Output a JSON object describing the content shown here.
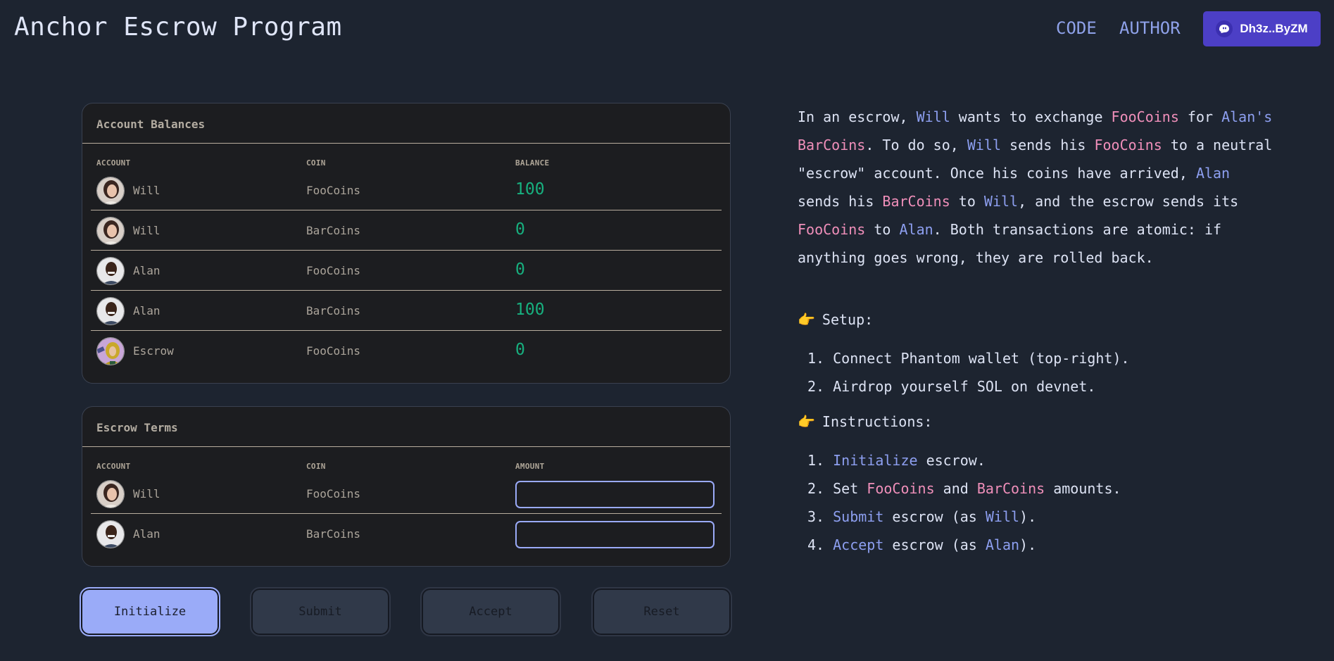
{
  "header": {
    "title": "Anchor Escrow Program",
    "nav": [
      {
        "label": "CODE"
      },
      {
        "label": "AUTHOR"
      }
    ],
    "wallet": {
      "icon": "phantom-ghost-icon",
      "label": "Dh3z..ByZM"
    }
  },
  "balances": {
    "title": "Account Balances",
    "columns": [
      "ACCOUNT",
      "COIN",
      "BALANCE"
    ],
    "rows": [
      {
        "account": "Will",
        "coin": "FooCoins",
        "balance": "100",
        "avatar": "will"
      },
      {
        "account": "Will",
        "coin": "BarCoins",
        "balance": "0",
        "avatar": "will"
      },
      {
        "account": "Alan",
        "coin": "FooCoins",
        "balance": "0",
        "avatar": "alan"
      },
      {
        "account": "Alan",
        "coin": "BarCoins",
        "balance": "100",
        "avatar": "alan"
      },
      {
        "account": "Escrow",
        "coin": "FooCoins",
        "balance": "0",
        "avatar": "escrow"
      }
    ]
  },
  "terms": {
    "title": "Escrow Terms",
    "columns": [
      "ACCOUNT",
      "COIN",
      "AMOUNT"
    ],
    "rows": [
      {
        "account": "Will",
        "coin": "FooCoins",
        "amount": "",
        "avatar": "will"
      },
      {
        "account": "Alan",
        "coin": "BarCoins",
        "amount": "",
        "avatar": "alan"
      }
    ]
  },
  "actions": {
    "initialize": "Initialize",
    "submit": "Submit",
    "accept": "Accept",
    "reset": "Reset"
  },
  "info": {
    "intro": [
      {
        "t": "In an escrow, ",
        "c": ""
      },
      {
        "t": "Will",
        "c": "person"
      },
      {
        "t": " wants to exchange ",
        "c": ""
      },
      {
        "t": "FooCoins",
        "c": "coin"
      },
      {
        "t": " for ",
        "c": ""
      },
      {
        "t": "Alan's",
        "c": "person"
      },
      {
        "t": " ",
        "c": ""
      },
      {
        "t": "BarCoins",
        "c": "coin"
      },
      {
        "t": ". To do so, ",
        "c": ""
      },
      {
        "t": "Will",
        "c": "person"
      },
      {
        "t": " sends his ",
        "c": ""
      },
      {
        "t": "FooCoins",
        "c": "coin"
      },
      {
        "t": " to a neutral \"escrow\" account. Once his coins have arrived, ",
        "c": ""
      },
      {
        "t": "Alan",
        "c": "person"
      },
      {
        "t": " sends his ",
        "c": ""
      },
      {
        "t": "BarCoins",
        "c": "coin"
      },
      {
        "t": " to ",
        "c": ""
      },
      {
        "t": "Will",
        "c": "person"
      },
      {
        "t": ", and the escrow sends its ",
        "c": ""
      },
      {
        "t": "FooCoins",
        "c": "coin"
      },
      {
        "t": " to ",
        "c": ""
      },
      {
        "t": "Alan",
        "c": "person"
      },
      {
        "t": ". Both transactions are atomic: if anything goes wrong, they are rolled back.",
        "c": ""
      }
    ],
    "setup_heading": "Setup:",
    "setup_steps": [
      [
        {
          "t": "1. Connect Phantom wallet (top-right).",
          "c": ""
        }
      ],
      [
        {
          "t": "2. Airdrop yourself SOL on devnet.",
          "c": ""
        }
      ]
    ],
    "instructions_heading": "Instructions:",
    "instruction_steps": [
      [
        {
          "t": "1. ",
          "c": ""
        },
        {
          "t": "Initialize",
          "c": "person"
        },
        {
          "t": " escrow.",
          "c": ""
        }
      ],
      [
        {
          "t": "2. Set ",
          "c": ""
        },
        {
          "t": "FooCoins",
          "c": "coin"
        },
        {
          "t": " and ",
          "c": ""
        },
        {
          "t": "BarCoins",
          "c": "coin"
        },
        {
          "t": " amounts.",
          "c": ""
        }
      ],
      [
        {
          "t": "3. ",
          "c": ""
        },
        {
          "t": "Submit",
          "c": "person"
        },
        {
          "t": " escrow (as ",
          "c": ""
        },
        {
          "t": "Will",
          "c": "person"
        },
        {
          "t": ").",
          "c": ""
        }
      ],
      [
        {
          "t": "4. ",
          "c": ""
        },
        {
          "t": "Accept",
          "c": "person"
        },
        {
          "t": " escrow (as ",
          "c": ""
        },
        {
          "t": "Alan",
          "c": "person"
        },
        {
          "t": ").",
          "c": ""
        }
      ]
    ],
    "pointer_icon": "👉"
  },
  "colors": {
    "background": "#1d2430",
    "accent": "#9aabf8",
    "wallet": "#4c3fc6",
    "balance": "#17b07f",
    "person_highlight": "#8d9ff0",
    "coin_highlight": "#f08fba"
  }
}
